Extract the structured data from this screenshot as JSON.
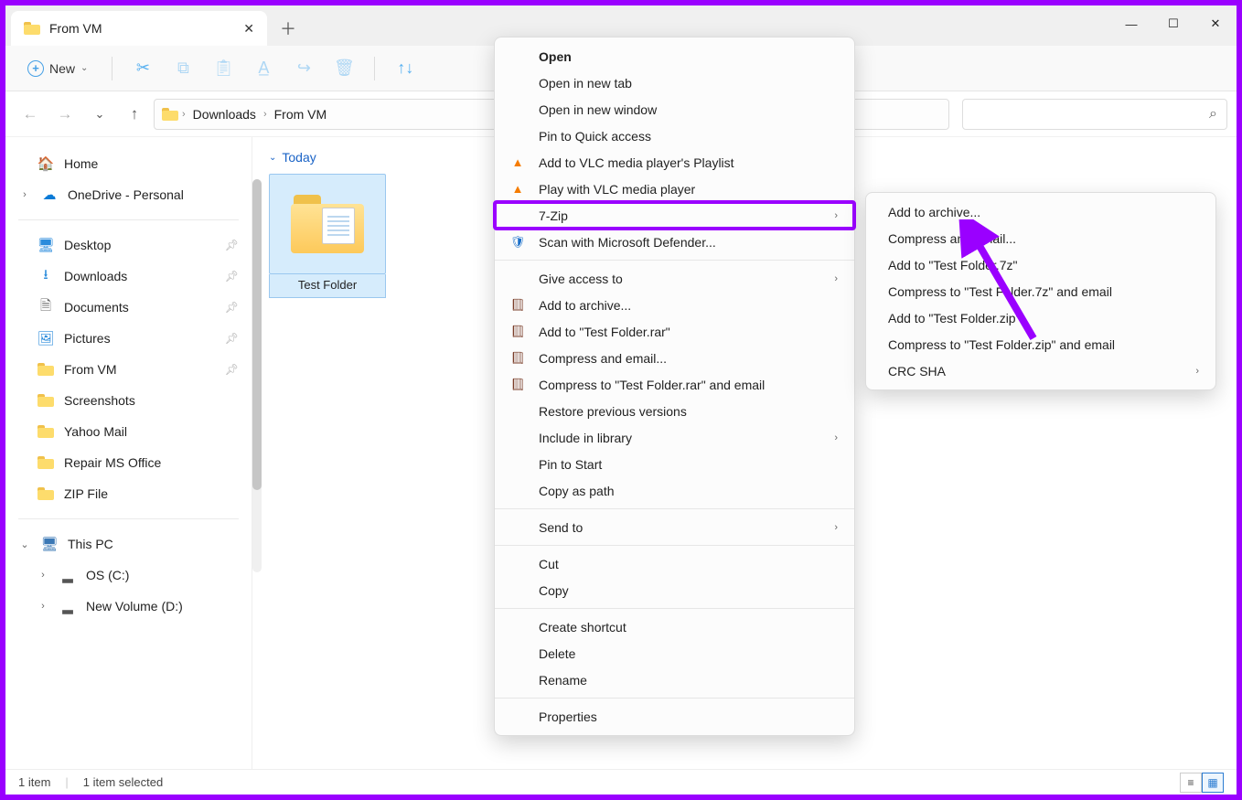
{
  "titlebar": {
    "tab_title": "From VM"
  },
  "toolbar": {
    "new_label": "New"
  },
  "breadcrumb": {
    "items": [
      "Downloads",
      "From VM"
    ]
  },
  "sidebar": {
    "home": "Home",
    "onedrive": "OneDrive - Personal",
    "quick": [
      {
        "label": "Desktop",
        "pinned": true,
        "color": "#2c8cdc"
      },
      {
        "label": "Downloads",
        "pinned": true,
        "color": "#2c8cdc"
      },
      {
        "label": "Documents",
        "pinned": true,
        "color": "#6a6a6a"
      },
      {
        "label": "Pictures",
        "pinned": true,
        "color": "#2c8cdc"
      },
      {
        "label": "From VM",
        "pinned": true
      },
      {
        "label": "Screenshots",
        "pinned": false
      },
      {
        "label": "Yahoo Mail",
        "pinned": false
      },
      {
        "label": "Repair MS Office",
        "pinned": false
      },
      {
        "label": "ZIP File",
        "pinned": false
      }
    ],
    "this_pc": "This PC",
    "drives": [
      "OS (C:)",
      "New Volume (D:)"
    ]
  },
  "content": {
    "group": "Today",
    "item": "Test Folder"
  },
  "statusbar": {
    "count": "1 item",
    "selected": "1 item selected"
  },
  "context_menu": {
    "items": [
      {
        "label": "Open",
        "bold": true
      },
      {
        "label": "Open in new tab"
      },
      {
        "label": "Open in new window"
      },
      {
        "label": "Pin to Quick access"
      },
      {
        "label": "Add to VLC media player's Playlist",
        "icon": "vlc"
      },
      {
        "label": "Play with VLC media player",
        "icon": "vlc"
      },
      {
        "label": "7-Zip",
        "submenu": true,
        "highlight": true
      },
      {
        "label": "Scan with Microsoft Defender...",
        "icon": "shield"
      },
      {
        "sep": true
      },
      {
        "label": "Give access to",
        "submenu": true
      },
      {
        "label": "Add to archive...",
        "icon": "rar"
      },
      {
        "label": "Add to \"Test Folder.rar\"",
        "icon": "rar"
      },
      {
        "label": "Compress and email...",
        "icon": "rar"
      },
      {
        "label": "Compress to \"Test Folder.rar\" and email",
        "icon": "rar"
      },
      {
        "label": "Restore previous versions"
      },
      {
        "label": "Include in library",
        "submenu": true
      },
      {
        "label": "Pin to Start"
      },
      {
        "label": "Copy as path"
      },
      {
        "sep": true
      },
      {
        "label": "Send to",
        "submenu": true
      },
      {
        "sep": true
      },
      {
        "label": "Cut"
      },
      {
        "label": "Copy"
      },
      {
        "sep": true
      },
      {
        "label": "Create shortcut"
      },
      {
        "label": "Delete"
      },
      {
        "label": "Rename"
      },
      {
        "sep": true
      },
      {
        "label": "Properties"
      }
    ]
  },
  "submenu": {
    "items": [
      {
        "label": "Add to archive..."
      },
      {
        "label": "Compress and email..."
      },
      {
        "label": "Add to \"Test Folder.7z\""
      },
      {
        "label": "Compress to \"Test Folder.7z\" and email"
      },
      {
        "label": "Add to \"Test Folder.zip\""
      },
      {
        "label": "Compress to \"Test Folder.zip\" and email"
      },
      {
        "label": "CRC SHA",
        "submenu": true
      }
    ]
  }
}
